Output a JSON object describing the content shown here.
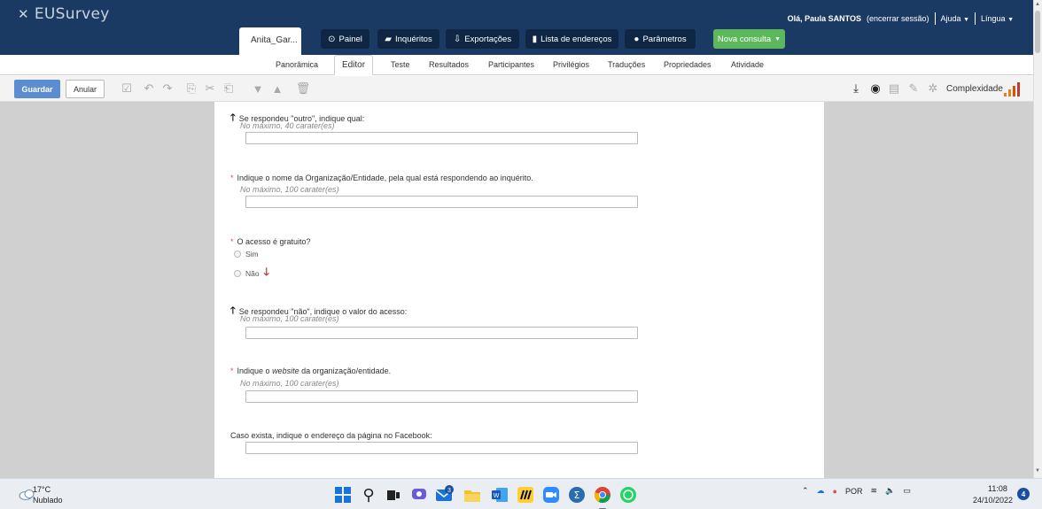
{
  "app": {
    "logo_text": "EUSurvey"
  },
  "user": {
    "greeting": "Olá, Paula SANTOS",
    "logout": "(encerrar sessão)",
    "help": "Ajuda",
    "language": "Língua"
  },
  "survey_tab": "Anita_Gar...",
  "main_nav": {
    "painel": "Painel",
    "inqueritos": "Inquéritos",
    "exportacoes": "Exportações",
    "lista": "Lista de endereços",
    "parametros": "Parâmetros",
    "nova": "Nova consulta"
  },
  "sub_nav": {
    "panoramica": "Panorâmica",
    "editor": "Editor",
    "teste": "Teste",
    "resultados": "Resultados",
    "participantes": "Participantes",
    "privilegios": "Privilégios",
    "traducoes": "Traduções",
    "propriedades": "Propriedades",
    "atividade": "Atividade"
  },
  "toolbar": {
    "save": "Guardar",
    "cancel": "Anular",
    "complexity": "Complexidade"
  },
  "questions": [
    {
      "title": "Se respondeu \"outro\", indique qual:",
      "hint": "No máximo, 40 carater(es)"
    },
    {
      "title": "Indique o nome da Organização/Entidade, pela qual está respondendo ao inquérito.",
      "hint": "No máximo, 100 carater(es)"
    },
    {
      "title": "O acesso é gratuito?",
      "options": [
        "Sim",
        "Não"
      ]
    },
    {
      "title": "Se respondeu \"não\", indique o valor do acesso:",
      "hint": "No máximo, 100 carater(es)"
    },
    {
      "title_pre": "Indique o ",
      "title_em": "website",
      "title_post": " da organização/entidade.",
      "hint": "No máximo, 100 carater(es)"
    },
    {
      "title": "Caso exista, indique o endereço da página no Facebook:"
    }
  ],
  "taskbar": {
    "temperature": "17°C",
    "condition": "Nublado",
    "language": "POR",
    "time": "11:08",
    "date": "24/10/2022",
    "notifications": "4",
    "mail_badge": "3"
  },
  "colors": {
    "header": "#1b3a63",
    "nav_button": "#0f2745",
    "new_button": "#5cb85c",
    "save_button": "#5b8dd0",
    "required": "#d9534f"
  }
}
